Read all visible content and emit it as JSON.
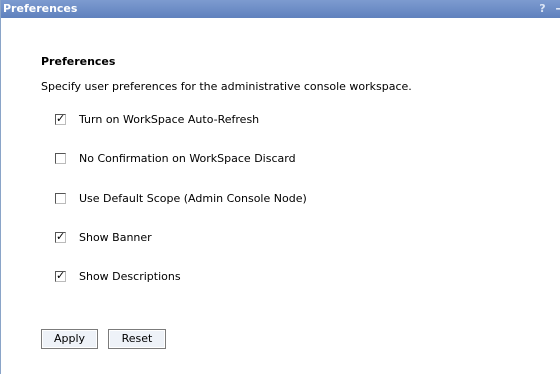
{
  "window": {
    "title": "Preferences",
    "help_glyph": "?",
    "minimize_glyph": "–"
  },
  "section": {
    "title": "Preferences",
    "description": "Specify user preferences for the administrative console workspace."
  },
  "options": [
    {
      "label": "Turn on WorkSpace Auto-Refresh",
      "checked": true
    },
    {
      "label": "No Confirmation on WorkSpace Discard",
      "checked": false
    },
    {
      "label": "Use Default Scope (Admin Console Node)",
      "checked": false
    },
    {
      "label": "Show Banner",
      "checked": true
    },
    {
      "label": "Show Descriptions",
      "checked": true
    }
  ],
  "check_glyph": "✓",
  "buttons": {
    "apply": "Apply",
    "reset": "Reset"
  },
  "colors": {
    "titlebar": "#6e8fc7",
    "button_bg": "#eef2f8"
  }
}
